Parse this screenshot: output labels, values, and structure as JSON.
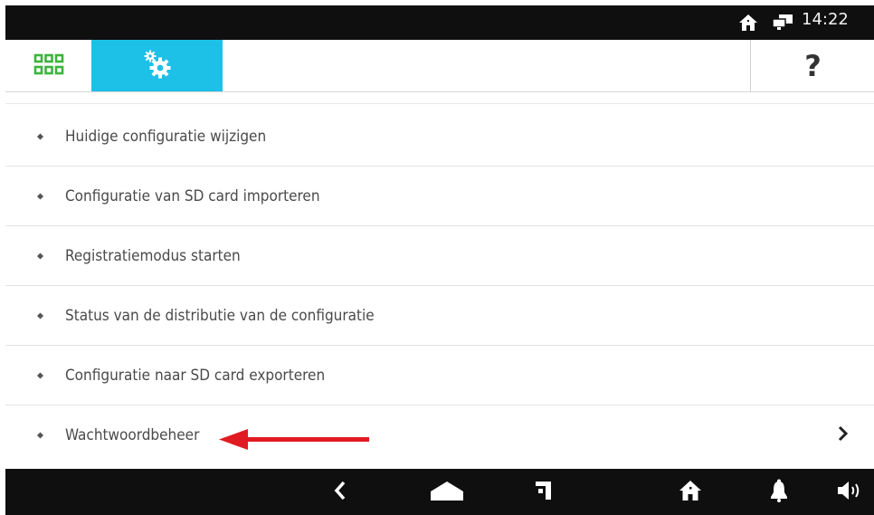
{
  "status_bar": {
    "time": "14:22"
  },
  "toolbar": {
    "help_label": "?"
  },
  "menu": {
    "items": [
      {
        "label": "Huidige configuratie wijzigen"
      },
      {
        "label": "Configuratie van SD card importeren"
      },
      {
        "label": "Registratiemodus starten"
      },
      {
        "label": "Status van de distributie van de configuratie"
      },
      {
        "label": "Configuratie naar SD card exporteren"
      },
      {
        "label": "Wachtwoordbeheer"
      }
    ]
  },
  "colors": {
    "accent": "#1dc1e8",
    "apps_grid": "#3cb43c",
    "annotation_arrow": "#e11b22",
    "bars": "#0f0f0f"
  },
  "icons": {
    "status": [
      "home-icon",
      "network-icon"
    ],
    "toolbar": [
      "apps-grid-icon",
      "settings-gears-icon"
    ],
    "nav": [
      "back-icon",
      "home-nav-icon",
      "recent-apps-icon",
      "house-icon",
      "bell-icon",
      "volume-icon"
    ]
  }
}
